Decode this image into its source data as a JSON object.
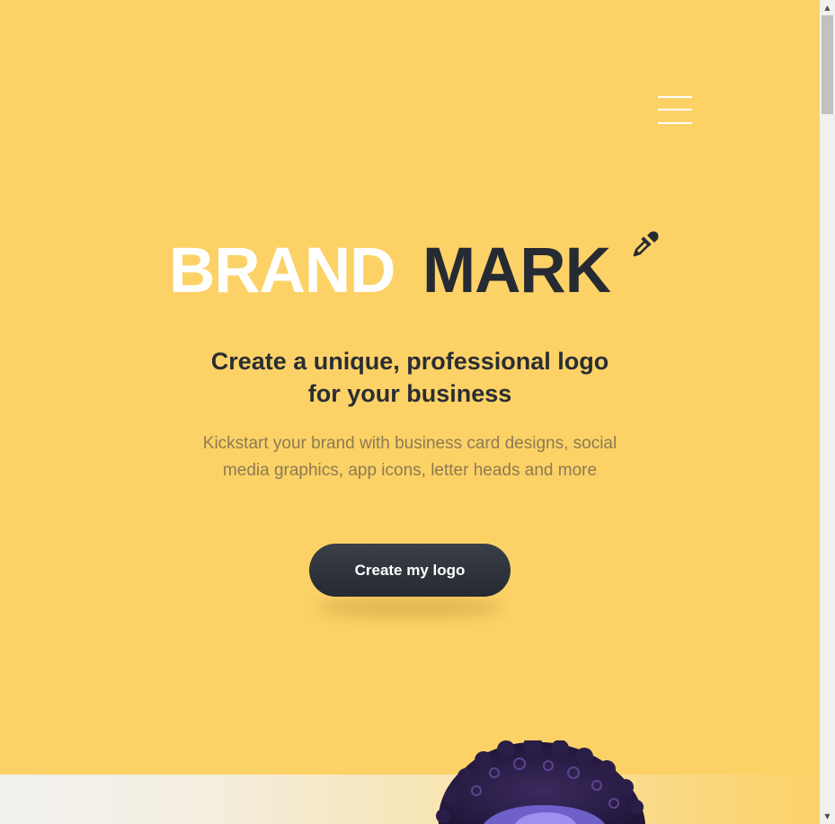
{
  "header": {
    "menu_icon": "hamburger-menu-icon"
  },
  "hero": {
    "logo": {
      "word1": "BRAND",
      "word2": "MARK",
      "icon": "eyedropper-icon",
      "color_light": "#ffffff",
      "color_dark": "#262a33"
    },
    "headline_line1": "Create a unique, professional logo",
    "headline_line2": "for your business",
    "subtext_line1": "Kickstart your brand with business card designs, social",
    "subtext_line2": "media graphics, app icons, letter heads and more",
    "cta_label": "Create my logo"
  },
  "scrollbar": {
    "up_arrow": "▲",
    "down_arrow": "▼"
  },
  "colors": {
    "background": "#fcd267",
    "button": "#2a2e35",
    "subtext": "#8c7b52"
  }
}
